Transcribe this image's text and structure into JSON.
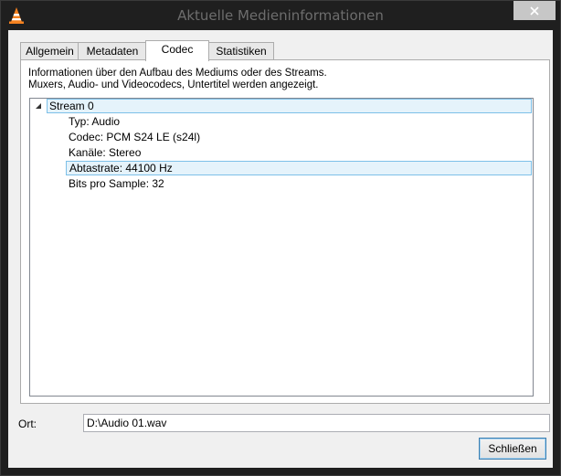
{
  "window": {
    "title": "Aktuelle Medieninformationen",
    "icon": "vlc-cone-icon",
    "close_icon": "close-icon"
  },
  "tabs": [
    {
      "label": "Allgemein",
      "active": false
    },
    {
      "label": "Metadaten",
      "active": false
    },
    {
      "label": "Codec",
      "active": true
    },
    {
      "label": "Statistiken",
      "active": false
    }
  ],
  "codec": {
    "info_line1": "Informationen über den Aufbau des Mediums oder des Streams.",
    "info_line2": "Muxers, Audio- und Videocodecs, Untertitel werden angezeigt.",
    "tree": {
      "stream_label": "Stream 0",
      "items": [
        {
          "text": "Typ: Audio",
          "selected": false
        },
        {
          "text": "Codec: PCM S24 LE (s24l)",
          "selected": false
        },
        {
          "text": "Kanäle: Stereo",
          "selected": false
        },
        {
          "text": "Abtastrate: 44100 Hz",
          "selected": true
        },
        {
          "text": "Bits pro Sample: 32",
          "selected": false
        }
      ]
    }
  },
  "footer": {
    "location_label": "Ort:",
    "location_value": "D:\\Audio 01.wav",
    "close_button": "Schließen"
  },
  "colors": {
    "title_bar": "#1f1f1f",
    "selection_bg": "#e5f3fb",
    "selection_border": "#7dc0e8",
    "vlc_orange": "#f58220"
  }
}
